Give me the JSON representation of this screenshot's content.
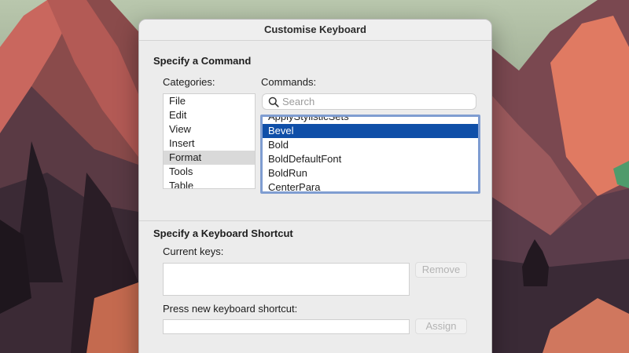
{
  "dialog": {
    "title": "Customise Keyboard"
  },
  "command_section": {
    "title": "Specify a Command",
    "categories_label": "Categories:",
    "commands_label": "Commands:",
    "categories": [
      "File",
      "Edit",
      "View",
      "Insert",
      "Format",
      "Tools",
      "Table"
    ],
    "selected_category": "Format",
    "search_placeholder": "Search",
    "commands": [
      "ApplyStylisticSets",
      "Bevel",
      "Bold",
      "BoldDefaultFont",
      "BoldRun",
      "CenterPara"
    ],
    "selected_command": "Bevel"
  },
  "shortcut_section": {
    "title": "Specify a Keyboard Shortcut",
    "current_keys_label": "Current keys:",
    "remove_button": "Remove",
    "press_new_label": "Press new keyboard shortcut:",
    "assign_button": "Assign"
  },
  "colors": {
    "selection_accent": "#0f4fa8",
    "focus_ring": "#7f9dd1"
  }
}
